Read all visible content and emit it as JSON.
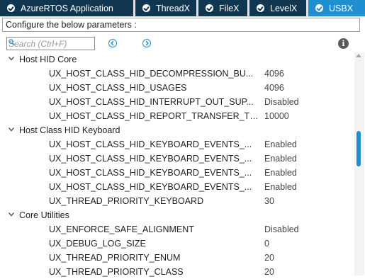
{
  "tabs": [
    {
      "label": "AzureRTOS Application",
      "active": false
    },
    {
      "label": "ThreadX",
      "active": false
    },
    {
      "label": "FileX",
      "active": false
    },
    {
      "label": "LevelX",
      "active": false
    },
    {
      "label": "USBX",
      "active": true
    }
  ],
  "config_label": "Configure the below parameters :",
  "search": {
    "placeholder": "Search (Ctrl+F)",
    "value": ""
  },
  "icons": {
    "tab_check": "check-circle-icon",
    "search": "search-icon",
    "prev": "arrow-left-circle-icon",
    "next": "arrow-right-circle-icon",
    "info": "info-icon",
    "expand": "chevron-down-icon"
  },
  "groups": [
    {
      "label": "Host HID Core",
      "params": [
        {
          "name": "UX_HOST_CLASS_HID_DECOMPRESSION_BU...",
          "value": "4096"
        },
        {
          "name": "UX_HOST_CLASS_HID_USAGES",
          "value": "4096"
        },
        {
          "name": "UX_HOST_CLASS_HID_INTERRUPT_OUT_SUP...",
          "value": "Disabled"
        },
        {
          "name": "UX_HOST_CLASS_HID_REPORT_TRANSFER_TI...",
          "value": "10000"
        }
      ]
    },
    {
      "label": "Host Class HID Keyboard",
      "params": [
        {
          "name": "UX_HOST_CLASS_HID_KEYBOARD_EVENTS_...",
          "value": "Enabled"
        },
        {
          "name": "UX_HOST_CLASS_HID_KEYBOARD_EVENTS_...",
          "value": "Enabled"
        },
        {
          "name": "UX_HOST_CLASS_HID_KEYBOARD_EVENTS_...",
          "value": "Enabled"
        },
        {
          "name": "UX_HOST_CLASS_HID_KEYBOARD_EVENTS_...",
          "value": "Enabled"
        },
        {
          "name": "UX_THREAD_PRIORITY_KEYBOARD",
          "value": "30"
        }
      ]
    },
    {
      "label": "Core Utilities",
      "params": [
        {
          "name": "UX_ENFORCE_SAFE_ALIGNMENT",
          "value": "Disabled"
        },
        {
          "name": "UX_DEBUG_LOG_SIZE",
          "value": "0"
        },
        {
          "name": "UX_THREAD_PRIORITY_ENUM",
          "value": "20"
        },
        {
          "name": "UX_THREAD_PRIORITY_CLASS",
          "value": "20"
        }
      ]
    }
  ],
  "colors": {
    "tab_bg": "#10374f",
    "tab_active": "#1f8fcf",
    "scroll_thumb": "#1f8fcf"
  }
}
